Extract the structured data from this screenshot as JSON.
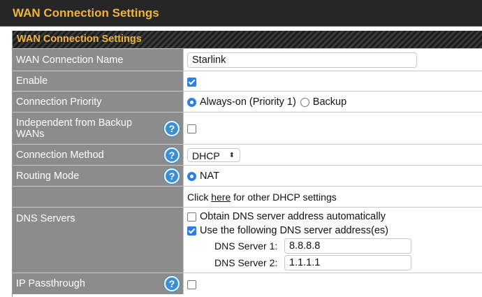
{
  "page": {
    "title": "WAN Connection Settings"
  },
  "panel": {
    "title": "WAN Connection Settings"
  },
  "rows": {
    "connection_name": {
      "label": "WAN Connection Name",
      "value": "Starlink"
    },
    "enable": {
      "label": "Enable",
      "checked": true
    },
    "priority": {
      "label": "Connection Priority",
      "options": [
        "Always-on (Priority 1)",
        "Backup"
      ],
      "selected": "Always-on (Priority 1)"
    },
    "independent": {
      "label": "Independent from Backup WANs",
      "checked": false
    },
    "method": {
      "label": "Connection Method",
      "value": "DHCP"
    },
    "routing": {
      "label": "Routing Mode",
      "option": "NAT",
      "selected": "NAT"
    },
    "dhcp_link": {
      "prefix": "Click ",
      "link": "here",
      "suffix": " for other DHCP settings"
    },
    "dns": {
      "label": "DNS Servers",
      "auto_label": "Obtain DNS server address automatically",
      "auto_checked": false,
      "manual_label": "Use the following DNS server address(es)",
      "manual_checked": true,
      "server1_label": "DNS Server 1:",
      "server1_value": "8.8.8.8",
      "server2_label": "DNS Server 2:",
      "server2_value": "1.1.1.1"
    },
    "passthrough": {
      "label": "IP Passthrough",
      "checked": false
    }
  },
  "icons": {
    "help": "help-icon"
  },
  "colors": {
    "header_bg": "#262626",
    "header_text": "#f0b43c",
    "label_bg": "#8c8c8c",
    "accent": "#2f7ee8",
    "help": "#3b8fd6"
  }
}
